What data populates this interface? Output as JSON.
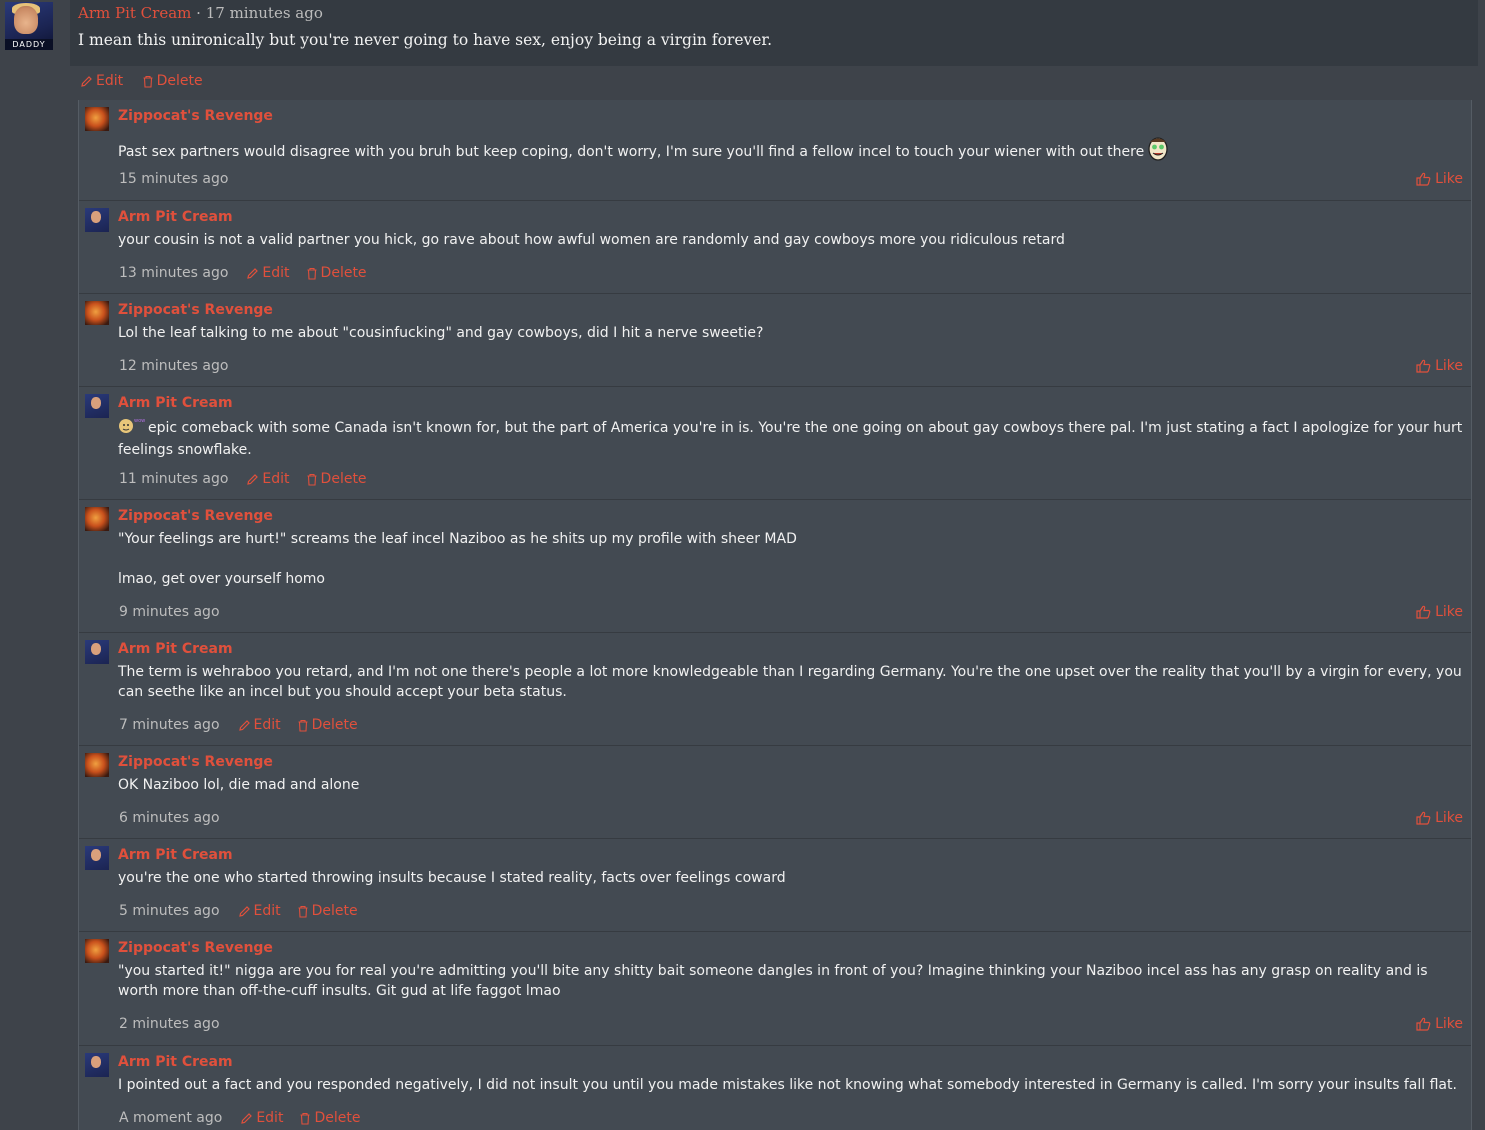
{
  "post": {
    "author": "Arm Pit Cream",
    "separator": "·",
    "time": "17 minutes ago",
    "body": "I mean this unironically but you're never going to have sex, enjoy being a virgin forever.",
    "avatar_badge": "DADDY",
    "edit_label": "Edit",
    "delete_label": "Delete"
  },
  "labels": {
    "like": "Like",
    "edit": "Edit",
    "delete": "Delete"
  },
  "replies": [
    {
      "author": "Zippocat's Revenge",
      "text": [
        "Past sex partners would disagree with you bruh but keep coping, don't worry, I'm sure you'll find a fellow incel to touch your wiener with out there"
      ],
      "time": "15 minutes ago",
      "own": false,
      "emoji_after": "smiley-face-icon"
    },
    {
      "author": "Arm Pit Cream",
      "text": [
        "your cousin is not a valid partner you hick, go rave about how awful women are randomly and gay cowboys more you ridiculous retard"
      ],
      "time": "13 minutes ago",
      "own": true
    },
    {
      "author": "Zippocat's Revenge",
      "text": [
        "Lol the leaf talking to me about \"cousinfucking\" and gay cowboys, did I hit a nerve sweetie?"
      ],
      "time": "12 minutes ago",
      "own": false
    },
    {
      "author": "Arm Pit Cream",
      "text": [
        "epic comeback with some Canada isn't known for, but the part of America you're in is. You're the one going on about gay cowboys there pal. I'm just stating a fact I apologize for your hurt feelings snowflake."
      ],
      "time": "11 minutes ago",
      "own": true,
      "emoji_before": "doge-emote-icon"
    },
    {
      "author": "Zippocat's Revenge",
      "text": [
        "\"Your feelings are hurt!\" screams the leaf incel Naziboo as he shits up my profile with sheer MAD",
        "",
        "lmao, get over yourself homo"
      ],
      "time": "9 minutes ago",
      "own": false
    },
    {
      "author": "Arm Pit Cream",
      "text": [
        "The term is wehraboo you retard, and I'm not one there's people a lot more knowledgeable than I regarding Germany. You're the one upset over the reality that you'll by a virgin for every, you can seethe like an incel but you should accept your beta status."
      ],
      "time": "7 minutes ago",
      "own": true
    },
    {
      "author": "Zippocat's Revenge",
      "text": [
        "OK Naziboo lol, die mad and alone"
      ],
      "time": "6 minutes ago",
      "own": false
    },
    {
      "author": "Arm Pit Cream",
      "text": [
        "you're the one who started throwing insults because I stated reality, facts over feelings coward"
      ],
      "time": "5 minutes ago",
      "own": true
    },
    {
      "author": "Zippocat's Revenge",
      "text": [
        "\"you started it!\" nigga are you for real you're admitting you'll bite any shitty bait someone dangles in front of you? Imagine thinking your Naziboo incel ass has any grasp on reality and is worth more than off-the-cuff insults. Git gud at life faggot lmao"
      ],
      "time": "2 minutes ago",
      "own": false
    },
    {
      "author": "Arm Pit Cream",
      "text": [
        "I pointed out a fact and you responded negatively, I did not insult you until you made mistakes like not knowing what somebody interested in Germany is called. I'm sorry your insults fall flat."
      ],
      "time": "A moment ago",
      "own": true
    }
  ]
}
